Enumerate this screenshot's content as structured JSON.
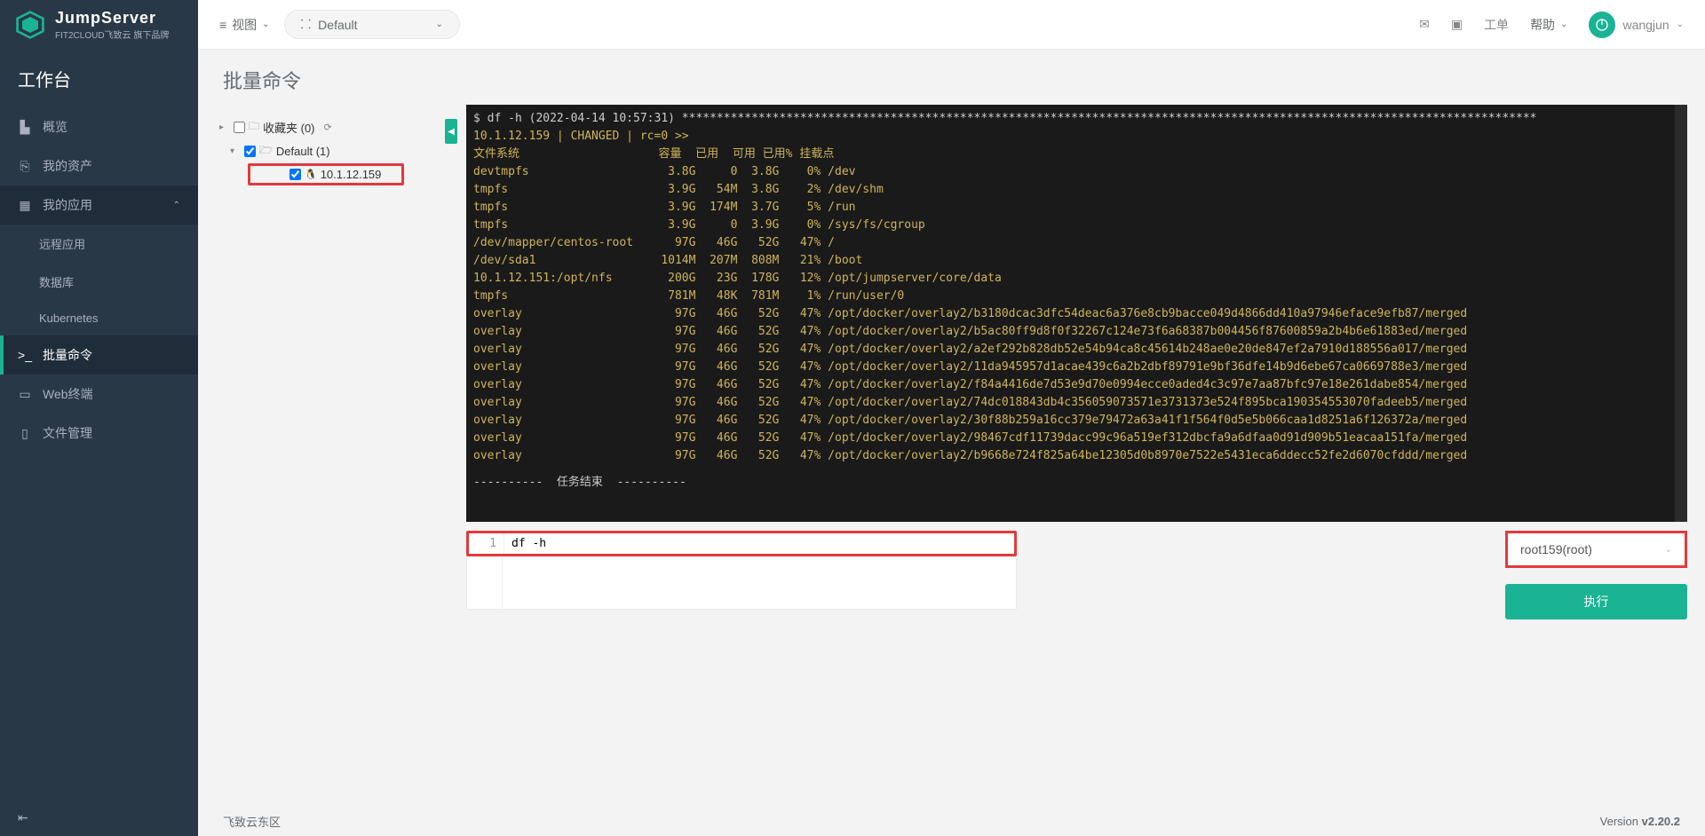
{
  "brand": {
    "name": "JumpServer",
    "sub": "FIT2CLOUD飞致云 旗下品牌"
  },
  "sidebar": {
    "title": "工作台",
    "items": [
      {
        "label": "概览"
      },
      {
        "label": "我的资产"
      },
      {
        "label": "我的应用"
      },
      {
        "label": "远程应用"
      },
      {
        "label": "数据库"
      },
      {
        "label": "Kubernetes"
      },
      {
        "label": "批量命令"
      },
      {
        "label": "Web终端"
      },
      {
        "label": "文件管理"
      }
    ]
  },
  "topbar": {
    "view_label": "视图",
    "org_label": "Default",
    "ticket_label": "工单",
    "help_label": "帮助",
    "username": "wangjun"
  },
  "page": {
    "title": "批量命令"
  },
  "tree": {
    "fav_label": "收藏夹 (0)",
    "default_label": "Default (1)",
    "host": "10.1.12.159"
  },
  "terminal": {
    "cmd": "$ df -h (2022-04-14 10:57:31) ***************************************************************************************************************************",
    "host_line": "10.1.12.159 | CHANGED | rc=0 >>",
    "header": "文件系统                    容量  已用  可用 已用% 挂载点",
    "rows": [
      "devtmpfs                    3.8G     0  3.8G    0% /dev",
      "tmpfs                       3.9G   54M  3.8G    2% /dev/shm",
      "tmpfs                       3.9G  174M  3.7G    5% /run",
      "tmpfs                       3.9G     0  3.9G    0% /sys/fs/cgroup",
      "/dev/mapper/centos-root      97G   46G   52G   47% /",
      "/dev/sda1                  1014M  207M  808M   21% /boot",
      "10.1.12.151:/opt/nfs        200G   23G  178G   12% /opt/jumpserver/core/data",
      "tmpfs                       781M   48K  781M    1% /run/user/0",
      "overlay                      97G   46G   52G   47% /opt/docker/overlay2/b3180dcac3dfc54deac6a376e8cb9bacce049d4866dd410a97946eface9efb87/merged",
      "overlay                      97G   46G   52G   47% /opt/docker/overlay2/b5ac80ff9d8f0f32267c124e73f6a68387b004456f87600859a2b4b6e61883ed/merged",
      "overlay                      97G   46G   52G   47% /opt/docker/overlay2/a2ef292b828db52e54b94ca8c45614b248ae0e20de847ef2a7910d188556a017/merged",
      "overlay                      97G   46G   52G   47% /opt/docker/overlay2/11da945957d1acae439c6a2b2dbf89791e9bf36dfe14b9d6ebe67ca0669788e3/merged",
      "overlay                      97G   46G   52G   47% /opt/docker/overlay2/f84a4416de7d53e9d70e0994ecce0aded4c3c97e7aa87bfc97e18e261dabe854/merged",
      "overlay                      97G   46G   52G   47% /opt/docker/overlay2/74dc018843db4c356059073571e3731373e524f895bca190354553070fadeeb5/merged",
      "overlay                      97G   46G   52G   47% /opt/docker/overlay2/30f88b259a16cc379e79472a63a41f1f564f0d5e5b066caa1d8251a6f126372a/merged",
      "overlay                      97G   46G   52G   47% /opt/docker/overlay2/98467cdf11739dacc99c96a519ef312dbcfa9a6dfaa0d91d909b51eacaa151fa/merged",
      "overlay                      97G   46G   52G   47% /opt/docker/overlay2/b9668e724f825a64be12305d0b8970e7522e5431eca6ddecc52fe2d6070cfddd/merged"
    ],
    "end": "----------  任务结束  ----------"
  },
  "input": {
    "line_no": "1",
    "command": "df -h",
    "run_as": "root159(root)",
    "run_label": "执行"
  },
  "footer": {
    "region": "飞致云东区",
    "version_prefix": "Version ",
    "version": "v2.20.2"
  }
}
